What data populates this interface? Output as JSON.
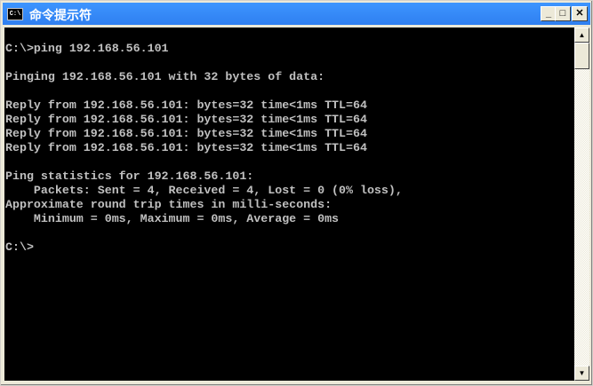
{
  "window": {
    "title": "命令提示符",
    "icon_text": "C:\\"
  },
  "buttons": {
    "minimize": "_",
    "maximize": "□",
    "close": "✕"
  },
  "scrollbar": {
    "up": "▲",
    "down": "▼"
  },
  "console_lines": [
    "",
    "C:\\>ping 192.168.56.101",
    "",
    "Pinging 192.168.56.101 with 32 bytes of data:",
    "",
    "Reply from 192.168.56.101: bytes=32 time<1ms TTL=64",
    "Reply from 192.168.56.101: bytes=32 time<1ms TTL=64",
    "Reply from 192.168.56.101: bytes=32 time<1ms TTL=64",
    "Reply from 192.168.56.101: bytes=32 time<1ms TTL=64",
    "",
    "Ping statistics for 192.168.56.101:",
    "    Packets: Sent = 4, Received = 4, Lost = 0 (0% loss),",
    "Approximate round trip times in milli-seconds:",
    "    Minimum = 0ms, Maximum = 0ms, Average = 0ms",
    "",
    "C:\\>"
  ]
}
